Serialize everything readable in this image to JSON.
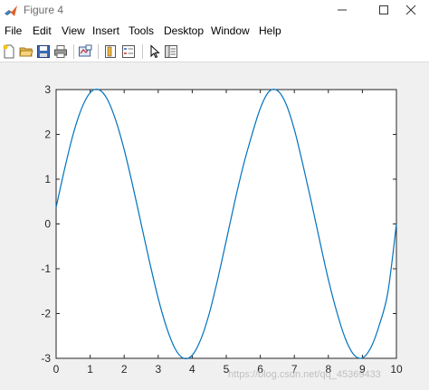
{
  "window": {
    "title": "Figure 4"
  },
  "menu": [
    "File",
    "Edit",
    "View",
    "Insert",
    "Tools",
    "Desktop",
    "Window",
    "Help"
  ],
  "toolbar": {
    "icons": [
      "new-figure-icon",
      "open-file-icon",
      "save-icon",
      "print-icon",
      "link-plot-icon",
      "insert-colorbar-icon",
      "insert-legend-icon",
      "edit-plot-icon",
      "property-inspector-icon"
    ]
  },
  "watermark": "https://blog.csdn.net/qq_45369433",
  "chart_data": {
    "type": "line",
    "title": "",
    "xlabel": "",
    "ylabel": "",
    "xlim": [
      0,
      10
    ],
    "ylim": [
      -3,
      3
    ],
    "xticks": [
      0,
      1,
      2,
      3,
      4,
      5,
      6,
      7,
      8,
      9,
      10
    ],
    "yticks": [
      -3,
      -2,
      -1,
      0,
      1,
      2,
      3
    ],
    "xtick_labels": [
      "0",
      "1",
      "2",
      "3",
      "4",
      "5",
      "6",
      "7",
      "8",
      "9",
      "10"
    ],
    "ytick_labels": [
      "-3",
      "-2",
      "-1",
      "0",
      "1",
      "2",
      "3"
    ],
    "grid": false,
    "line_color": "#0072BD",
    "series": [
      {
        "x": [
          0,
          0.25,
          0.5,
          0.75,
          1,
          1.25,
          1.5,
          1.75,
          2,
          2.25,
          2.5,
          2.75,
          3,
          3.25,
          3.5,
          3.75,
          4,
          4.25,
          4.5,
          4.75,
          5,
          5.25,
          5.5,
          5.75,
          6,
          6.25,
          6.5,
          6.75,
          7,
          7.25,
          7.5,
          7.75,
          8,
          8.25,
          8.5,
          8.75,
          9,
          9.25,
          9.5,
          9.75,
          10
        ],
        "y": [
          0.37,
          1.23,
          2.0,
          2.58,
          2.93,
          3.0,
          2.79,
          2.32,
          1.66,
          0.86,
          0.0,
          -0.86,
          -1.66,
          -2.32,
          -2.79,
          -3.0,
          -2.93,
          -2.58,
          -2.0,
          -1.23,
          -0.37,
          0.5,
          1.3,
          1.98,
          2.58,
          2.95,
          2.98,
          2.69,
          2.11,
          1.33,
          0.49,
          -0.39,
          -1.24,
          -1.97,
          -2.56,
          -2.92,
          -2.99,
          -2.76,
          -2.25,
          -1.52,
          0.0
        ]
      }
    ]
  }
}
